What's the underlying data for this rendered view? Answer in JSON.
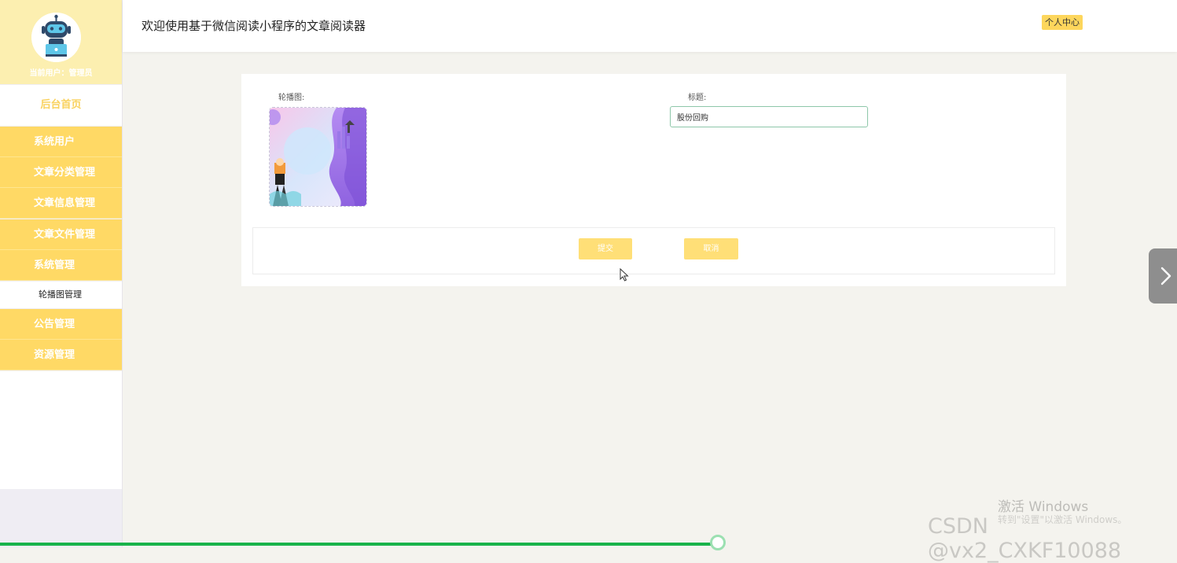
{
  "sidebar": {
    "current_user": "当前用户：管理员",
    "home": "后台首页",
    "items": [
      {
        "label": "系统用户"
      },
      {
        "label": "文章分类管理"
      },
      {
        "label": "文章信息管理"
      },
      {
        "label": "文章文件管理"
      },
      {
        "label": "系统管理"
      },
      {
        "label": "公告管理"
      },
      {
        "label": "资源管理"
      }
    ],
    "sub_item": "轮播图管理"
  },
  "header": {
    "title": "欢迎使用基于微信阅读小程序的文章阅读器",
    "profile": "个人中心"
  },
  "form": {
    "image_label": "轮播图:",
    "title_label": "标题:",
    "title_value": "股份回购",
    "submit": "提交",
    "cancel": "取消"
  },
  "watermark": {
    "activate_title": "激活 Windows",
    "activate_sub": "转到\"设置\"以激活 Windows。",
    "csdn": "CSDN @vx2_CXKF10088"
  },
  "progress": {
    "value_percent": 61
  },
  "colors": {
    "accent": "#ffd965",
    "header_bg": "#fcefb0",
    "button": "#ffdf77",
    "progress": "#19b34b"
  }
}
